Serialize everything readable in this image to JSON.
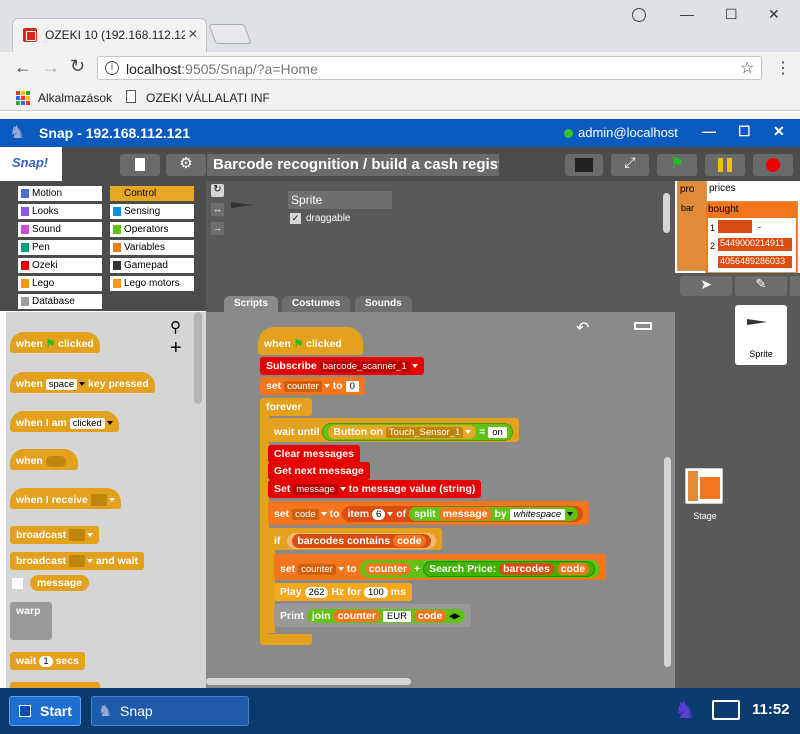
{
  "browser": {
    "tab_title": "OZEKI 10 (192.168.112.12",
    "url_host": "localhost",
    "url_rest": ":9505/Snap/?a=Home",
    "bookmarks": [
      "Alkalmazások",
      "OZEKI VÁLLALATI INF"
    ]
  },
  "snap": {
    "window_title": "Snap - 192.168.112.121",
    "user": "admin@localhost",
    "logo": "Snap!",
    "project_title": "Barcode recognition / build a cash register",
    "categories": [
      {
        "label": "Motion",
        "color": "#4a6cd4"
      },
      {
        "label": "Control",
        "color": "#e6a822"
      },
      {
        "label": "Looks",
        "color": "#8f56e3"
      },
      {
        "label": "Sensing",
        "color": "#0494dc"
      },
      {
        "label": "Sound",
        "color": "#cf4ad9"
      },
      {
        "label": "Operators",
        "color": "#62c213"
      },
      {
        "label": "Pen",
        "color": "#00a178"
      },
      {
        "label": "Variables",
        "color": "#ee7d16"
      },
      {
        "label": "Ozeki",
        "color": "#e60000"
      },
      {
        "label": "Gamepad",
        "color": "#333333"
      },
      {
        "label": "Lego",
        "color": "#f29b1b"
      },
      {
        "label": "Lego motors",
        "color": "#f29b1b"
      },
      {
        "label": "Database",
        "color": "#9e9e9e"
      }
    ],
    "sprite_name": "Sprite",
    "draggable_label": "draggable",
    "tabs": [
      "Scripts",
      "Costumes",
      "Sounds"
    ],
    "palette": {
      "when_flag": [
        "when",
        "clicked"
      ],
      "when_key": [
        "when",
        "space",
        "key pressed"
      ],
      "when_i_am": [
        "when I am",
        "clicked"
      ],
      "when_generic": "when",
      "when_receive": "when I receive",
      "broadcast": "broadcast",
      "broadcast_wait": [
        "broadcast",
        "and wait"
      ],
      "message": "message",
      "warp": "warp",
      "wait": [
        "wait",
        "1",
        "secs"
      ]
    },
    "script": {
      "hat": [
        "when",
        "clicked"
      ],
      "subscribe": [
        "Subscribe",
        "barcode_scanner_1"
      ],
      "set_counter": [
        "set",
        "counter",
        "to",
        "0"
      ],
      "forever": "forever",
      "wait_until": [
        "wait until",
        "Button",
        "on",
        "Touch_Sensor_1",
        "=",
        "on"
      ],
      "clear": "Clear messages",
      "get_next": "Get next message",
      "set_message": [
        "Set",
        "message",
        "to message value (string)"
      ],
      "set_code": [
        "set",
        "code",
        "to",
        "item",
        "6",
        "of",
        "split",
        "message",
        "by",
        "whitespace"
      ],
      "if": "if",
      "barcodes_contains": [
        "barcodes",
        "contains",
        "code"
      ],
      "set_counter2": [
        "set",
        "counter",
        "to",
        "counter",
        "+",
        "Search Price:",
        "barcodes",
        "code"
      ],
      "play": [
        "Play",
        "262",
        "Hz for",
        "100",
        "ms"
      ],
      "print": [
        "Print",
        "join",
        "counter",
        "EUR",
        "code"
      ]
    },
    "vars": {
      "prices_label": "prices",
      "pro_label": "pro",
      "bar_label": "bar",
      "bought_label": "bought",
      "row1_val": "-",
      "row2_val": "5449000214911",
      "row3_val": "4056489286033",
      "rows": [
        "1",
        "2"
      ]
    },
    "corral": {
      "sprite": "Sprite",
      "stage": "Stage"
    }
  },
  "taskbar": {
    "start": "Start",
    "app": "Snap",
    "time": "11:52"
  }
}
